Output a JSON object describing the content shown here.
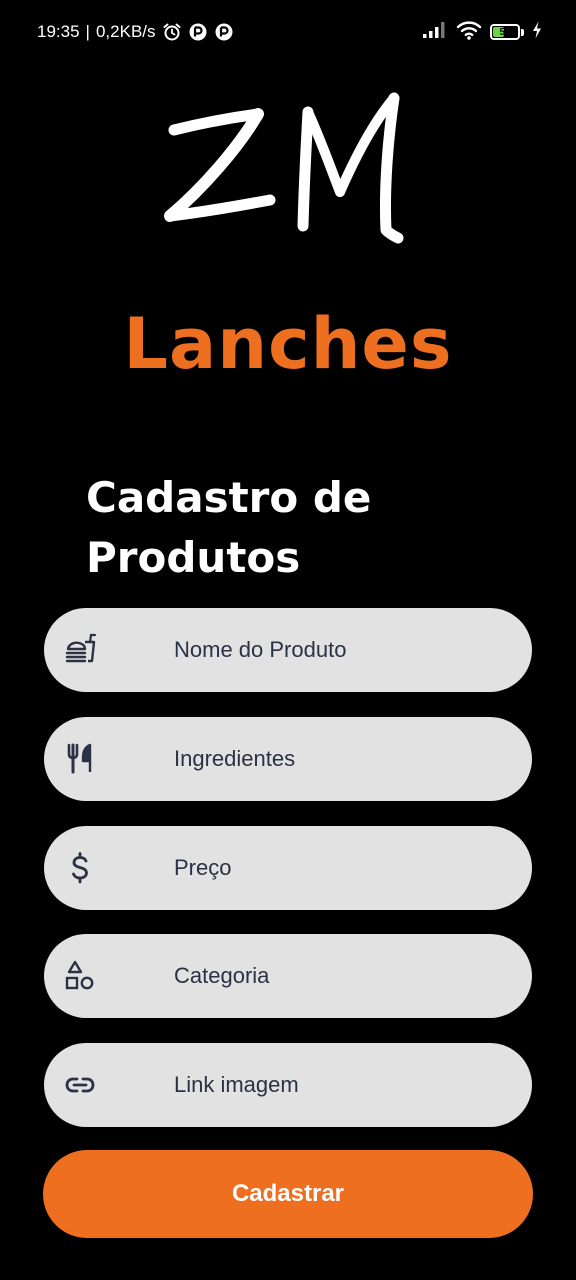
{
  "status_bar": {
    "time": "19:35",
    "separator": "|",
    "network_speed": "0,2KB/s",
    "left_icons": [
      "alarm-icon",
      "app-notification-icon",
      "app-notification-icon"
    ],
    "right_icons": [
      "signal-icon",
      "wifi-icon",
      "battery-icon",
      "charging-icon"
    ],
    "battery_level": "50",
    "battery_fraction": 0.5,
    "battery_color": "#6fd34a"
  },
  "brand": {
    "logo_text": "ZM",
    "name": "Lanches",
    "accent_color": "#ee6f1f"
  },
  "form": {
    "title": "Cadastro de Produtos",
    "fields": [
      {
        "placeholder": "Nome do Produto",
        "value": "",
        "icon": "fastfood-icon"
      },
      {
        "placeholder": "Ingredientes",
        "value": "",
        "icon": "restaurant-icon"
      },
      {
        "placeholder": "Preço",
        "value": "",
        "icon": "dollar-icon"
      },
      {
        "placeholder": "Categoria",
        "value": "",
        "icon": "category-icon"
      },
      {
        "placeholder": "Link imagem",
        "value": "",
        "icon": "link-icon"
      }
    ],
    "field_background": "#e2e2e2",
    "submit_label": "Cadastrar"
  }
}
